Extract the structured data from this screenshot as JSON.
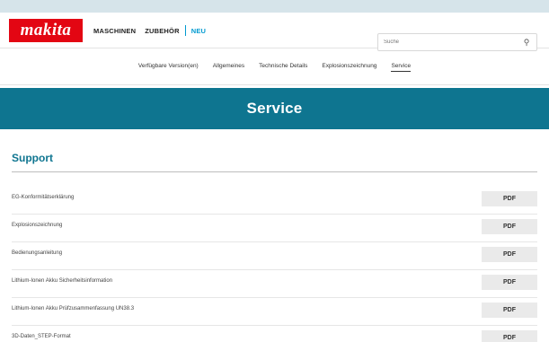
{
  "header": {
    "logo_text": "makita",
    "nav": [
      {
        "label": "MASCHINEN"
      },
      {
        "label": "ZUBEHÖR"
      },
      {
        "label": "NEU"
      }
    ],
    "search": {
      "placeholder": "Suche",
      "icon": "search-icon"
    }
  },
  "subnav": {
    "items": [
      {
        "label": "Verfügbare Version(en)"
      },
      {
        "label": "Allgemeines"
      },
      {
        "label": "Technische Details"
      },
      {
        "label": "Explosionszeichnung"
      },
      {
        "label": "Service",
        "active": true
      }
    ]
  },
  "banner": {
    "title": "Service"
  },
  "support": {
    "title": "Support",
    "items": [
      {
        "label": "EG-Konformitätserklärung",
        "button": "PDF"
      },
      {
        "label": "Explosionszeichnung",
        "button": "PDF"
      },
      {
        "label": "Bedienungsanleitung",
        "button": "PDF"
      },
      {
        "label": "Lithium-Ionen Akku Sicherheitsinformation",
        "button": "PDF"
      },
      {
        "label": "Lithium-Ionen Akku Prüfzusammenfassung UN38.3",
        "button": "PDF"
      },
      {
        "label": "3D-Daten_STEP-Format",
        "button": "PDF"
      }
    ]
  },
  "colors": {
    "brand_red": "#e30613",
    "accent_teal": "#0e7590",
    "link_blue": "#009ad0"
  }
}
